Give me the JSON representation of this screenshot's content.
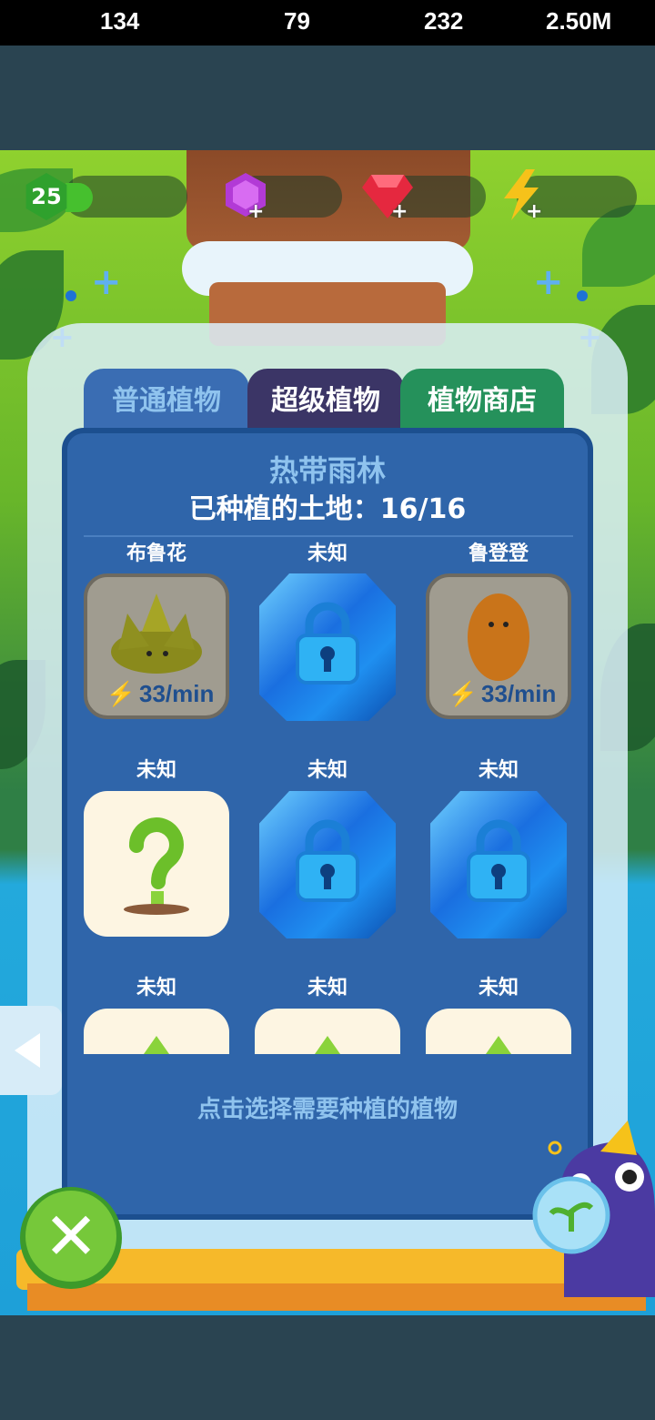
{
  "colors": {
    "tab_normal": "#3a6db3",
    "tab_super": "#3b3566",
    "tab_shop": "#25915b",
    "panel": "#2f65aa",
    "accent_yellow": "#f0b020"
  },
  "stats": {
    "level": "25",
    "xp": "134",
    "purple_gems": "79",
    "red_gems": "232",
    "energy": "2.50M"
  },
  "tabs": [
    {
      "label": "普通植物",
      "selected": true
    },
    {
      "label": "超级植物",
      "selected": false
    },
    {
      "label": "植物商店",
      "selected": false
    }
  ],
  "zone": {
    "title": "热带雨林",
    "planted": "已种植的土地：16/16"
  },
  "grid": [
    {
      "label": "布鲁花",
      "state": "plant",
      "rate": "33/min"
    },
    {
      "label": "未知",
      "state": "locked"
    },
    {
      "label": "鲁登登",
      "state": "plant",
      "rate": "33/min"
    },
    {
      "label": "未知",
      "state": "unknown"
    },
    {
      "label": "未知",
      "state": "locked"
    },
    {
      "label": "未知",
      "state": "locked"
    },
    {
      "label": "未知",
      "state": "unknown"
    },
    {
      "label": "未知",
      "state": "unknown"
    },
    {
      "label": "未知",
      "state": "unknown"
    }
  ],
  "hint": "点击选择需要种植的植物",
  "icons": {
    "back": "chevron-left-icon",
    "close": "close-icon",
    "energy": "lightning-icon"
  }
}
